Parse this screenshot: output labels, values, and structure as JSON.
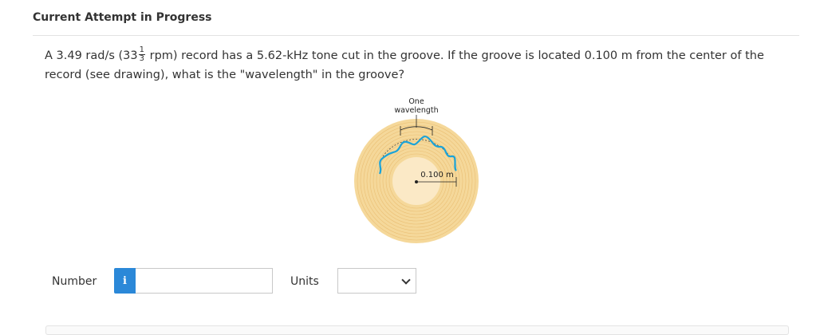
{
  "header": {
    "title": "Current Attempt in Progress"
  },
  "question": {
    "text_before": "A 3.49 rad/s (33",
    "fraction_numerator": "1",
    "fraction_denominator": "3",
    "text_after": " rpm) record has a 5.62-kHz tone cut in the groove. If the groove is located 0.100 m from the center of the record (see drawing), what is the \"wavelength\" in the groove?"
  },
  "figure": {
    "label_top_line1": "One",
    "label_top_line2": "wavelength",
    "radius_label": "0.100 m",
    "colors": {
      "record": "#f5d89a",
      "groove_line": "#e8b968",
      "center": "#fbe9c6",
      "wave": "#1ba3d8"
    }
  },
  "answer": {
    "number_label": "Number",
    "info_icon_glyph": "i",
    "number_value": "",
    "units_label": "Units",
    "units_selected": ""
  }
}
